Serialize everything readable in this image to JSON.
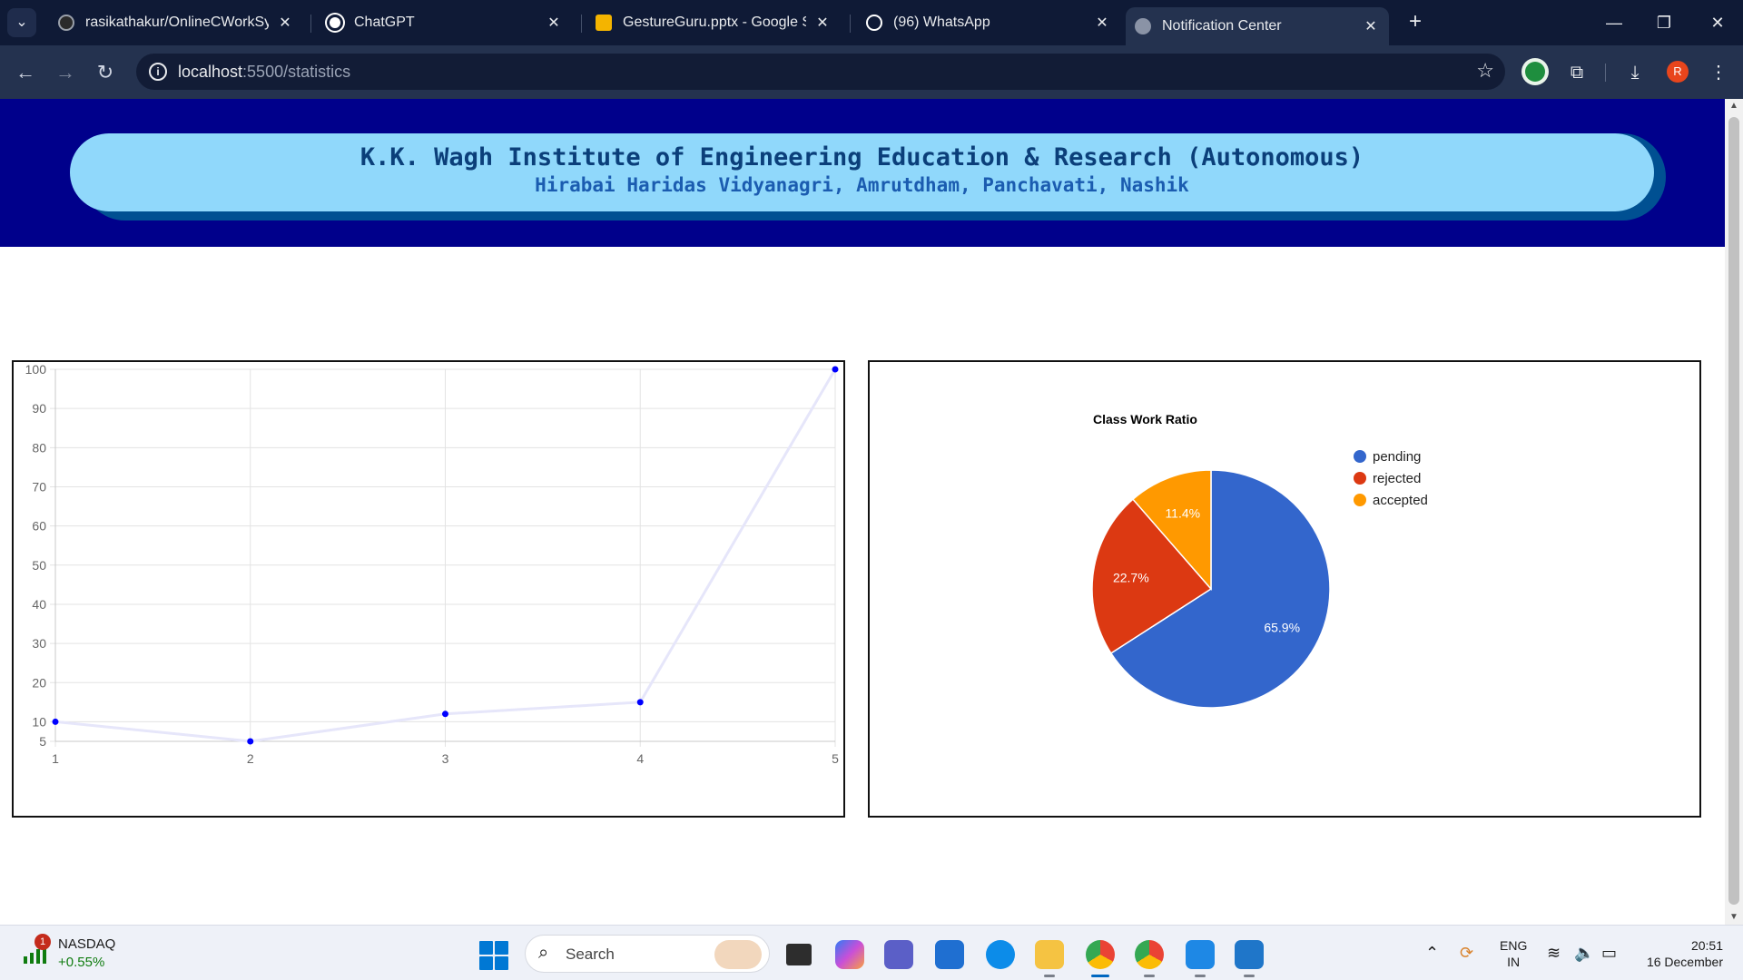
{
  "browser": {
    "tabs": [
      {
        "title": "rasikathakur/OnlineCWorkSyste",
        "favicon_color": "#2b2b2b",
        "active": false
      },
      {
        "title": "ChatGPT",
        "favicon_color": "#ffffff",
        "active": false
      },
      {
        "title": "GestureGuru.pptx - Google Slid",
        "favicon_color": "#f4b400",
        "active": false
      },
      {
        "title": "(96) WhatsApp",
        "favicon_color": "#25d366",
        "active": false
      },
      {
        "title": "Notification Center",
        "favicon_color": "#8a93a6",
        "active": true
      }
    ],
    "url_host": "localhost",
    "url_path": ":5500/statistics",
    "profile_initial": "R"
  },
  "page": {
    "title_line1": "K.K. Wagh Institute of Engineering Education & Research (Autonomous)",
    "title_line2": "Hirabai Haridas Vidyanagri, Amrutdham, Panchavati, Nashik"
  },
  "chart_data": [
    {
      "type": "line",
      "x": [
        1,
        2,
        3,
        4,
        5
      ],
      "values": [
        10,
        5,
        12,
        15,
        100
      ],
      "xlim": [
        1,
        5
      ],
      "ylim": [
        5,
        100
      ],
      "y_ticks": [
        5,
        10,
        20,
        30,
        40,
        50,
        60,
        70,
        80,
        90,
        100
      ],
      "x_ticks": [
        1,
        2,
        3,
        4,
        5
      ],
      "grid": true,
      "line_color": "#e6e6fa",
      "point_color": "#0000ff"
    },
    {
      "type": "pie",
      "title": "Class Work Ratio",
      "slices": [
        {
          "label": "pending",
          "value": 65.9,
          "display": "65.9%",
          "color": "#3366cc"
        },
        {
          "label": "rejected",
          "value": 22.7,
          "display": "22.7%",
          "color": "#dc3912"
        },
        {
          "label": "accepted",
          "value": 11.4,
          "display": "11.4%",
          "color": "#ff9900"
        }
      ],
      "legend": "right"
    }
  ],
  "taskbar": {
    "stock_badge": "1",
    "stock_name": "NASDAQ",
    "stock_change": "+0.55%",
    "search_placeholder": "Search",
    "lang_line1": "ENG",
    "lang_line2": "IN",
    "time": "20:51",
    "date": "16 December"
  }
}
